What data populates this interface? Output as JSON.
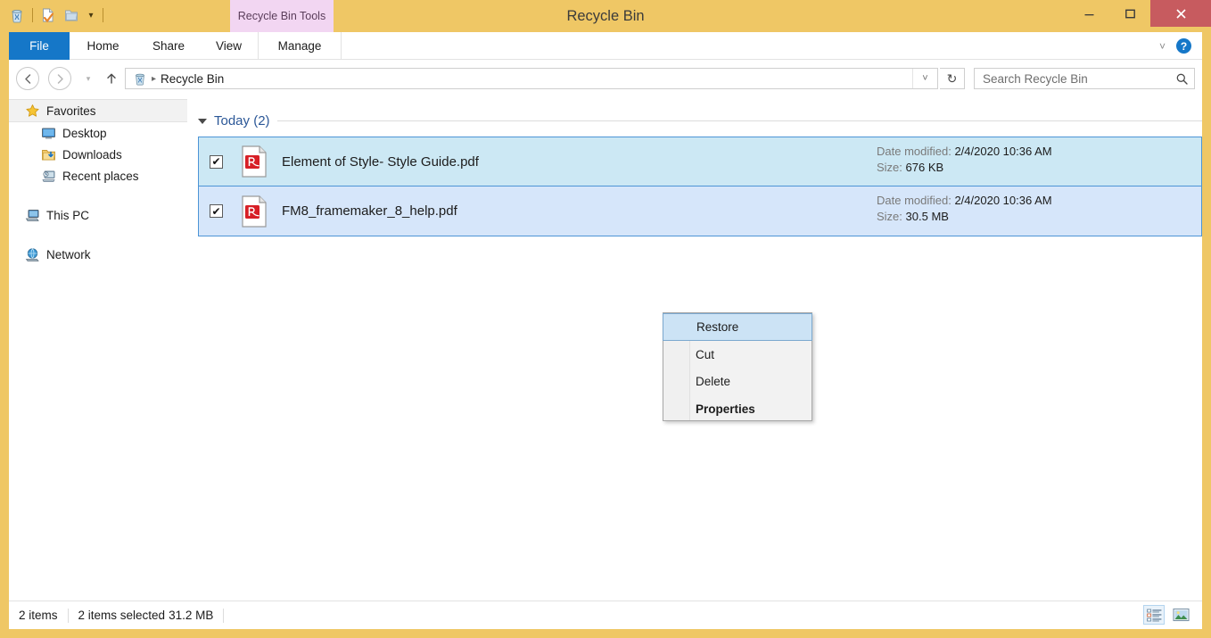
{
  "window": {
    "title": "Recycle Bin",
    "contextual_tools": "Recycle Bin Tools",
    "minimize": "–",
    "maximize": "❑",
    "close": "✕",
    "frame_color": "#efc765",
    "close_color": "#c75b5f"
  },
  "quick_access": {
    "items": [
      {
        "icon": "recycle-bin-icon",
        "label": "Recycle Bin"
      },
      {
        "icon": "properties-icon",
        "label": "Properties"
      },
      {
        "icon": "folder-icon",
        "label": "Open folder"
      }
    ],
    "customize_caret": "▾"
  },
  "ribbon": {
    "tabs": [
      {
        "id": "file",
        "label": "File",
        "selected": true
      },
      {
        "id": "home",
        "label": "Home",
        "selected": false
      },
      {
        "id": "share",
        "label": "Share",
        "selected": false
      },
      {
        "id": "view",
        "label": "View",
        "selected": false
      },
      {
        "id": "manage",
        "label": "Manage",
        "selected": false
      }
    ],
    "expand_caret": "˅",
    "help_label": "?",
    "accent_color": "#1577c8"
  },
  "address_bar": {
    "back": "←",
    "forward": "→",
    "history_caret": "▾",
    "up": "↑",
    "breadcrumb_separator": "▸",
    "breadcrumb": "Recycle Bin",
    "dropdown_caret": "˅",
    "refresh": "↻"
  },
  "search": {
    "placeholder": "Search Recycle Bin",
    "value": "",
    "icon": "search-icon"
  },
  "sidebar": {
    "items": [
      {
        "label": "Favorites",
        "icon": "star-icon",
        "child": false,
        "selected": true
      },
      {
        "label": "Desktop",
        "icon": "desktop-icon",
        "child": true,
        "selected": false
      },
      {
        "label": "Downloads",
        "icon": "downloads-icon",
        "child": true,
        "selected": false
      },
      {
        "label": "Recent places",
        "icon": "recent-places-icon",
        "child": true,
        "selected": false
      },
      {
        "label": "This PC",
        "icon": "this-pc-icon",
        "child": false,
        "selected": false
      },
      {
        "label": "Network",
        "icon": "network-icon",
        "child": false,
        "selected": false
      }
    ]
  },
  "file_list": {
    "group_label": "Today (2)",
    "group_collapse_icon": "triangle-down-icon",
    "meta_labels": {
      "date": "Date modified:",
      "size": "Size:"
    },
    "rows": [
      {
        "name": "Element of Style- Style Guide.pdf",
        "icon": "pdf-file-icon",
        "checked": true,
        "date_modified": "2/4/2020 10:36 AM",
        "size": "676 KB"
      },
      {
        "name": "FM8_framemaker_8_help.pdf",
        "icon": "pdf-file-icon",
        "checked": true,
        "date_modified": "2/4/2020 10:36 AM",
        "size": "30.5 MB"
      }
    ],
    "checkmark": "✔"
  },
  "context_menu": {
    "items": [
      {
        "label": "Restore",
        "highlighted": true,
        "bold": false
      },
      {
        "label": "Cut",
        "highlighted": false,
        "bold": false
      },
      {
        "label": "Delete",
        "highlighted": false,
        "bold": false
      },
      {
        "label": "Properties",
        "highlighted": false,
        "bold": true
      }
    ]
  },
  "status_bar": {
    "item_count": "2 items",
    "selection": "2 items selected",
    "selection_size": "31.2 MB",
    "views": [
      {
        "id": "details",
        "icon": "details-view-icon",
        "active": true
      },
      {
        "id": "large-icons",
        "icon": "large-icons-view-icon",
        "active": false
      }
    ]
  }
}
